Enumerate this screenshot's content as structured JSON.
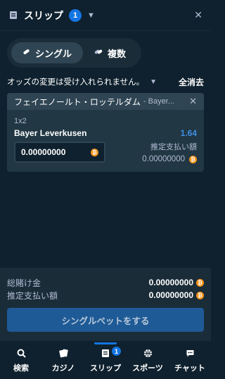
{
  "header": {
    "title": "スリップ",
    "count": "1",
    "icon": "betslip-icon",
    "close": "✕"
  },
  "tabs": [
    {
      "label": "シングル",
      "icon": "single-bet-icon",
      "active": true
    },
    {
      "label": "複数",
      "icon": "multi-bet-icon",
      "active": false
    }
  ],
  "notice": {
    "text": "オッズの変更は受け入れられません。",
    "clear_all": "全消去"
  },
  "bet": {
    "event": "フェイエノールト・ロッテルダム",
    "event_suffix": "- Bayer...",
    "market": "1x2",
    "selection": "Bayer Leverkusen",
    "odds": "1.64",
    "stake": "0.00000000",
    "payout_label": "推定支払い額",
    "payout_value": "0.00000000"
  },
  "summary": {
    "total_label": "総賭け金",
    "total_value": "0.00000000",
    "payout_label": "推定支払い額",
    "payout_value": "0.00000000",
    "place_button": "シングルベットをする"
  },
  "nav": [
    {
      "label": "検索",
      "icon": "search-icon"
    },
    {
      "label": "カジノ",
      "icon": "cards-icon"
    },
    {
      "label": "スリップ",
      "icon": "betslip-icon",
      "active": true,
      "badge": "1"
    },
    {
      "label": "スポーツ",
      "icon": "basketball-icon"
    },
    {
      "label": "チャット",
      "icon": "chat-icon"
    }
  ],
  "colors": {
    "background": "#0f212e",
    "panel": "#213743",
    "accent": "#1475e1",
    "coin": "#f7931a"
  }
}
